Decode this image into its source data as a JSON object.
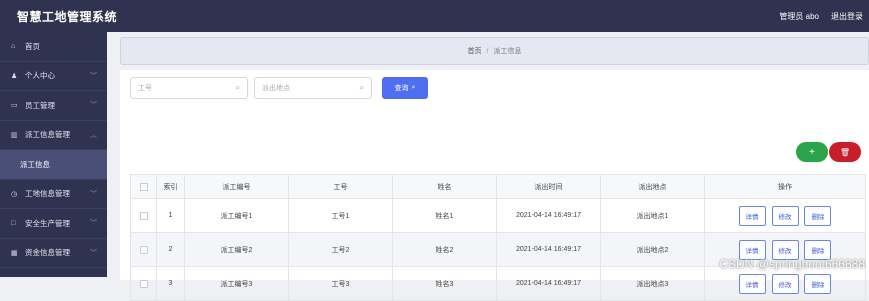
{
  "header": {
    "title": "智慧工地管理系统",
    "user_label": "管理员 abo",
    "logout_label": "退出登录"
  },
  "sidebar": {
    "items": [
      {
        "label": "首页",
        "icon": "home-icon",
        "glyph": "⌂",
        "has_chevron": false
      },
      {
        "label": "个人中心",
        "icon": "user-icon",
        "glyph": "♟",
        "has_chevron": true
      },
      {
        "label": "员工管理",
        "icon": "id-card-icon",
        "glyph": "▭",
        "has_chevron": true
      },
      {
        "label": "派工信息管理",
        "icon": "trash-icon",
        "glyph": "▥",
        "has_chevron": true,
        "expanded": true
      },
      {
        "label": "派工信息",
        "sub": true
      },
      {
        "label": "工地信息管理",
        "icon": "clock-icon",
        "glyph": "◷",
        "has_chevron": true
      },
      {
        "label": "安全生产管理",
        "icon": "square-icon",
        "glyph": "□",
        "has_chevron": true
      },
      {
        "label": "资金信息管理",
        "icon": "grid-icon",
        "glyph": "▦",
        "has_chevron": true
      }
    ]
  },
  "breadcrumb": {
    "home": "首页",
    "separator": "/",
    "current": "派工信息"
  },
  "search": {
    "field1_placeholder": "工号",
    "field2_placeholder": "派出地点",
    "query_label": "查询"
  },
  "actions": {
    "add_label": "+",
    "delete_label": "🗑"
  },
  "table": {
    "columns": [
      "",
      "索引",
      "派工编号",
      "工号",
      "姓名",
      "派出时间",
      "派出地点",
      "操作"
    ],
    "rows": [
      {
        "index": "1",
        "dispatch_no": "派工编号1",
        "job_no": "工号1",
        "name": "姓名1",
        "time": "2021-04-14 16:49:17",
        "place": "派出地点1"
      },
      {
        "index": "2",
        "dispatch_no": "派工编号2",
        "job_no": "工号2",
        "name": "姓名2",
        "time": "2021-04-14 16:49:17",
        "place": "派出地点2"
      },
      {
        "index": "3",
        "dispatch_no": "派工编号3",
        "job_no": "工号3",
        "name": "姓名3",
        "time": "2021-04-14 16:49:17",
        "place": "派出地点3"
      }
    ],
    "row_actions": {
      "detail": "详情",
      "edit": "修改",
      "delete": "删除"
    }
  },
  "watermark": "CSDN @springboot666888",
  "colors": {
    "header_bg": "#2f3350",
    "accent": "#4f6ef0",
    "add_green": "#2aa44a",
    "delete_red": "#c81e2a"
  }
}
